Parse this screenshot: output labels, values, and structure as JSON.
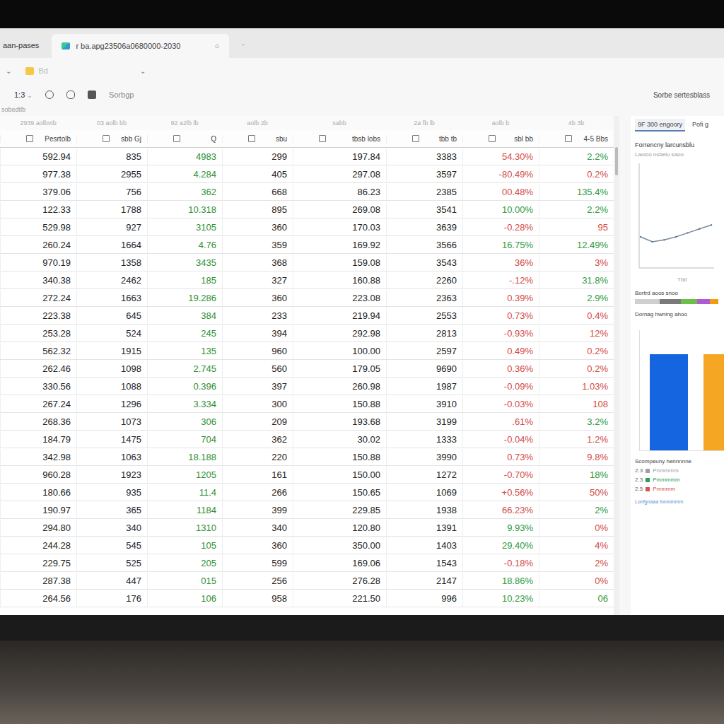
{
  "browser": {
    "left_tab": "aan-pases",
    "tab": {
      "title": "r ba.apg23506a0680000-2030",
      "close": "○",
      "selected": true
    },
    "new_tab": "-"
  },
  "address_bar": {
    "back": "⌄",
    "folder": "Bd",
    "dropdown": "⌄"
  },
  "toolbar": {
    "zoom": "1:3",
    "zoom_arrow": "⌄",
    "menu": "Sorbgp",
    "right_label": "Sorbe sertesblass"
  },
  "breadcrumb": "sobedtlb",
  "table": {
    "columns": [
      {
        "group": "2939 aolbvtb",
        "label": "Pesrtolb"
      },
      {
        "group": "03 aolb bb",
        "label": "sbb Gj"
      },
      {
        "group": "92 a2lb lb",
        "label": "Q"
      },
      {
        "group": "aolb 2b",
        "label": "sbu"
      },
      {
        "group": "sabb",
        "label": "tbsb lobs"
      },
      {
        "group": "2a fb lb",
        "label": "tbb tb"
      },
      {
        "group": "aolb b",
        "label": "sbl bb"
      },
      {
        "group": "4b 3b",
        "label": "4-5 Bbs"
      }
    ],
    "rows": [
      {
        "values": [
          "592.94",
          "835",
          "4983",
          "299",
          "197.84",
          "3383"
        ],
        "change": {
          "text": "54.30%",
          "positive": false
        },
        "delta": {
          "text": "2.2%",
          "positive": true
        }
      },
      {
        "values": [
          "977.38",
          "2955",
          "4.284",
          "405",
          "297.08",
          "3597"
        ],
        "change": {
          "text": "-80.49%",
          "positive": false
        },
        "delta": {
          "text": "0.2%",
          "positive": false
        }
      },
      {
        "values": [
          "379.06",
          "756",
          "362",
          "668",
          "86.23",
          "2385"
        ],
        "change": {
          "text": "00.48%",
          "positive": false
        },
        "delta": {
          "text": "135.4%",
          "positive": true
        }
      },
      {
        "values": [
          "122.33",
          "1788",
          "10.318",
          "895",
          "269.08",
          "3541"
        ],
        "change": {
          "text": "10.00%",
          "positive": true
        },
        "delta": {
          "text": "2.2%",
          "positive": true
        }
      },
      {
        "values": [
          "529.98",
          "927",
          "3105",
          "360",
          "170.03",
          "3639"
        ],
        "change": {
          "text": "-0.28%",
          "positive": false
        },
        "delta": {
          "text": "95",
          "positive": false
        }
      },
      {
        "values": [
          "260.24",
          "1664",
          "4.76",
          "359",
          "169.92",
          "3566"
        ],
        "change": {
          "text": "16.75%",
          "positive": true
        },
        "delta": {
          "text": "12.49%",
          "positive": true
        }
      },
      {
        "values": [
          "970.19",
          "1358",
          "3435",
          "368",
          "159.08",
          "3543"
        ],
        "change": {
          "text": "36%",
          "positive": false
        },
        "delta": {
          "text": "3%",
          "positive": false
        }
      },
      {
        "values": [
          "340.38",
          "2462",
          "185",
          "327",
          "160.88",
          "2260"
        ],
        "change": {
          "text": "-.12%",
          "positive": false
        },
        "delta": {
          "text": "31.8%",
          "positive": true
        }
      },
      {
        "values": [
          "272.24",
          "1663",
          "19.286",
          "360",
          "223.08",
          "2363"
        ],
        "change": {
          "text": "0.39%",
          "positive": false
        },
        "delta": {
          "text": "2.9%",
          "positive": true
        }
      },
      {
        "values": [
          "223.38",
          "645",
          "384",
          "233",
          "219.94",
          "2553"
        ],
        "change": {
          "text": "0.73%",
          "positive": false
        },
        "delta": {
          "text": "0.4%",
          "positive": false
        }
      },
      {
        "values": [
          "253.28",
          "524",
          "245",
          "394",
          "292.98",
          "2813"
        ],
        "change": {
          "text": "-0.93%",
          "positive": false
        },
        "delta": {
          "text": "12%",
          "positive": false
        }
      },
      {
        "values": [
          "562.32",
          "1915",
          "135",
          "960",
          "100.00",
          "2597"
        ],
        "change": {
          "text": "0.49%",
          "positive": false
        },
        "delta": {
          "text": "0.2%",
          "positive": false
        }
      },
      {
        "values": [
          "262.46",
          "1098",
          "2.745",
          "560",
          "179.05",
          "9690"
        ],
        "change": {
          "text": "0.36%",
          "positive": false
        },
        "delta": {
          "text": "0.2%",
          "positive": false
        }
      },
      {
        "values": [
          "330.56",
          "1088",
          "0.396",
          "397",
          "260.98",
          "1987"
        ],
        "change": {
          "text": "-0.09%",
          "positive": false
        },
        "delta": {
          "text": "1.03%",
          "positive": false
        }
      },
      {
        "values": [
          "267.24",
          "1296",
          "3.334",
          "300",
          "150.88",
          "3910"
        ],
        "change": {
          "text": "-0.03%",
          "positive": false
        },
        "delta": {
          "text": "108",
          "positive": false
        }
      },
      {
        "values": [
          "268.36",
          "1073",
          "306",
          "209",
          "193.68",
          "3199"
        ],
        "change": {
          "text": ".61%",
          "positive": false
        },
        "delta": {
          "text": "3.2%",
          "positive": true
        }
      },
      {
        "values": [
          "184.79",
          "1475",
          "704",
          "362",
          "30.02",
          "1333"
        ],
        "change": {
          "text": "-0.04%",
          "positive": false
        },
        "delta": {
          "text": "1.2%",
          "positive": false
        }
      },
      {
        "values": [
          "342.98",
          "1063",
          "18.188",
          "220",
          "150.88",
          "3990"
        ],
        "change": {
          "text": "0.73%",
          "positive": false
        },
        "delta": {
          "text": "9.8%",
          "positive": false
        }
      },
      {
        "values": [
          "960.28",
          "1923",
          "1205",
          "161",
          "150.00",
          "1272"
        ],
        "change": {
          "text": "-0.70%",
          "positive": false
        },
        "delta": {
          "text": "18%",
          "positive": true
        }
      },
      {
        "values": [
          "180.66",
          "935",
          "11.4",
          "266",
          "150.65",
          "1069"
        ],
        "change": {
          "text": "+0.56%",
          "positive": false
        },
        "delta": {
          "text": "50%",
          "positive": false
        }
      },
      {
        "values": [
          "190.97",
          "365",
          "1184",
          "399",
          "229.85",
          "1938"
        ],
        "change": {
          "text": "66.23%",
          "positive": false
        },
        "delta": {
          "text": "2%",
          "positive": true
        }
      },
      {
        "values": [
          "294.80",
          "340",
          "1310",
          "340",
          "120.80",
          "1391"
        ],
        "change": {
          "text": "9.93%",
          "positive": true
        },
        "delta": {
          "text": "0%",
          "positive": false
        }
      },
      {
        "values": [
          "244.28",
          "545",
          "105",
          "360",
          "350.00",
          "1403"
        ],
        "change": {
          "text": "29.40%",
          "positive": true
        },
        "delta": {
          "text": "4%",
          "positive": false
        }
      },
      {
        "values": [
          "229.75",
          "525",
          "205",
          "599",
          "169.06",
          "1543"
        ],
        "change": {
          "text": "-0.18%",
          "positive": false
        },
        "delta": {
          "text": "2%",
          "positive": false
        }
      },
      {
        "values": [
          "287.38",
          "447",
          "015",
          "256",
          "276.28",
          "2147"
        ],
        "change": {
          "text": "18.86%",
          "positive": true
        },
        "delta": {
          "text": "0%",
          "positive": false
        }
      },
      {
        "values": [
          "264.56",
          "176",
          "106",
          "958",
          "221.50",
          "996"
        ],
        "change": {
          "text": "10.23%",
          "positive": true
        },
        "delta": {
          "text": "06",
          "positive": true
        }
      }
    ]
  },
  "side_panel": {
    "tabs": [
      {
        "label": "9F 300 engoory",
        "selected": true
      },
      {
        "label": "Pofi g",
        "selected": false
      }
    ],
    "title": "Forrencny larcunsblu",
    "subtitle": "Laoslo nsbelu saoo",
    "line_chart": {
      "values": [
        3.0,
        2.5,
        2.7,
        3.0,
        3.4,
        3.8,
        4.2
      ],
      "axis_label": "Tbtl"
    },
    "legend_title": "Bortrd aoos snoo",
    "legend_segments": [
      {
        "color": "#cfcfcf",
        "level": 0.3
      },
      {
        "color": "#7a7a7a",
        "level": 0.25
      },
      {
        "color": "#6cc04a",
        "level": 0.2
      },
      {
        "color": "#b05bd6",
        "level": 0.15
      },
      {
        "color": "#f39c12",
        "level": 0.1
      }
    ],
    "bar_chart": {
      "title": "Dornag hwning ahoo",
      "series": [
        {
          "value": 85,
          "color": "#1565e0"
        },
        {
          "value": 85,
          "color": "#f5a623"
        }
      ]
    },
    "summary": {
      "title": "Scompeuny hennnnne",
      "items": [
        {
          "value": "2.3",
          "label": "Pnmmmm",
          "color": "#9e9e9e"
        },
        {
          "value": "2.3",
          "label": "Pmmmmm",
          "color": "#2e9e4f"
        },
        {
          "value": "2.5",
          "label": "Pnnnmm",
          "color": "#d9534f"
        }
      ]
    },
    "footer_link": "Lonfgnaaa fonmmmm"
  }
}
